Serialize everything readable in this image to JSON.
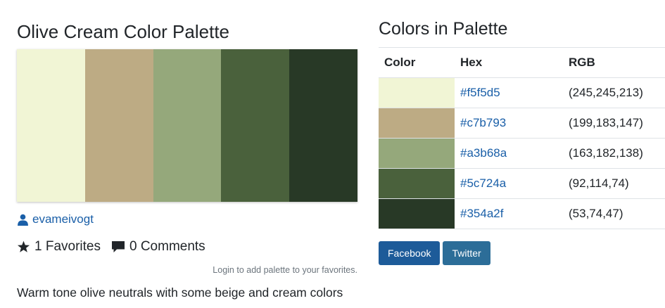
{
  "palette": {
    "title": "Olive Cream Color Palette",
    "author": "evameivogt",
    "favorites": "1 Favorites",
    "comments": "0 Comments",
    "login_note": "Login to add palette to your favorites.",
    "description": "Warm tone olive neutrals with some beige and cream colors"
  },
  "colors_section": {
    "title": "Colors in Palette",
    "headers": {
      "color": "Color",
      "hex": "Hex",
      "rgb": "RGB"
    },
    "rows": [
      {
        "color": "#f1f5d5",
        "hex": "#f5f5d5",
        "rgb": "(245,245,213)"
      },
      {
        "color": "#bdab84",
        "hex": "#c7b793",
        "rgb": "(199,183,147)"
      },
      {
        "color": "#95a87b",
        "hex": "#a3b68a",
        "rgb": "(163,182,138)"
      },
      {
        "color": "#4a613c",
        "hex": "#5c724a",
        "rgb": "(92,114,74)"
      },
      {
        "color": "#283926",
        "hex": "#354a2f",
        "rgb": "(53,74,47)"
      }
    ]
  },
  "share": {
    "facebook": "Facebook",
    "twitter": "Twitter"
  },
  "icons": {
    "author": "user-icon",
    "favorites": "star-icon",
    "comments": "comment-icon"
  }
}
